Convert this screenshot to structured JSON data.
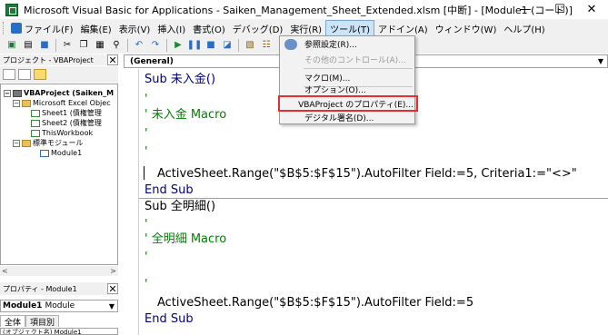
{
  "window": {
    "title": "Microsoft Visual Basic for Applications - Saiken_Management_Sheet_Extended.xlsm [中断] - [Module1 (コード)]",
    "minimize": "—",
    "maximize": "☐",
    "close": "✕"
  },
  "menubar": {
    "items": [
      {
        "label": "ファイル(F)"
      },
      {
        "label": "編集(E)"
      },
      {
        "label": "表示(V)"
      },
      {
        "label": "挿入(I)"
      },
      {
        "label": "書式(O)"
      },
      {
        "label": "デバッグ(D)"
      },
      {
        "label": "実行(R)"
      },
      {
        "label": "ツール(T)"
      },
      {
        "label": "アドイン(A)"
      },
      {
        "label": "ウィンドウ(W)"
      },
      {
        "label": "ヘルプ(H)"
      }
    ]
  },
  "project_pane": {
    "title": "プロジェクト - VBAProject",
    "close": "✕",
    "tree": {
      "project": "VBAProject (Saiken_M",
      "excel_objects": "Microsoft Excel Objec",
      "sheet1": "Sheet1 (債権管理",
      "sheet2": "Sheet2 (債権管理",
      "thisworkbook": "ThisWorkbook",
      "std_modules": "標準モジュール",
      "module1": "Module1"
    },
    "scroll_left": "<",
    "scroll_right": ">"
  },
  "properties_pane": {
    "title": "プロパティ - Module1",
    "close": "✕",
    "object_name": "Module1",
    "object_type": "Module",
    "tabs": [
      "全体",
      "項目別"
    ],
    "row": "(オブジェクト名) Module1"
  },
  "code_pane": {
    "object_combo": "(General)",
    "lines": {
      "sub1": "Sub 未入金()",
      "q1": "'",
      "c1": "' 未入金 Macro",
      "q2": "'",
      "blank1": "'",
      "stmt1": "ActiveSheet.Range(\"$B$5:$F$15\").AutoFilter Field:=5, Criteria1:=\"<>\"",
      "end1": "End Sub",
      "sub2": "Sub 全明細()",
      "q3": "'",
      "c2": "' 全明細 Macro",
      "q4": "'",
      "q5": "'",
      "stmt2": "ActiveSheet.Range(\"$B$5:$F$15\").AutoFilter Field:=5",
      "end2": "End Sub"
    }
  },
  "tools_menu": {
    "items": [
      {
        "label": "参照設定(R)...",
        "enabled": true
      },
      {
        "label": "その他のコントロール(A)...",
        "enabled": false
      },
      {
        "label": "マクロ(M)...",
        "enabled": true
      },
      {
        "label": "オプション(O)...",
        "enabled": true
      },
      {
        "label": "VBAProject のプロパティ(E)...",
        "enabled": true
      },
      {
        "label": "デジタル署名(D)...",
        "enabled": true
      }
    ],
    "highlighted_color": "#e03030"
  }
}
